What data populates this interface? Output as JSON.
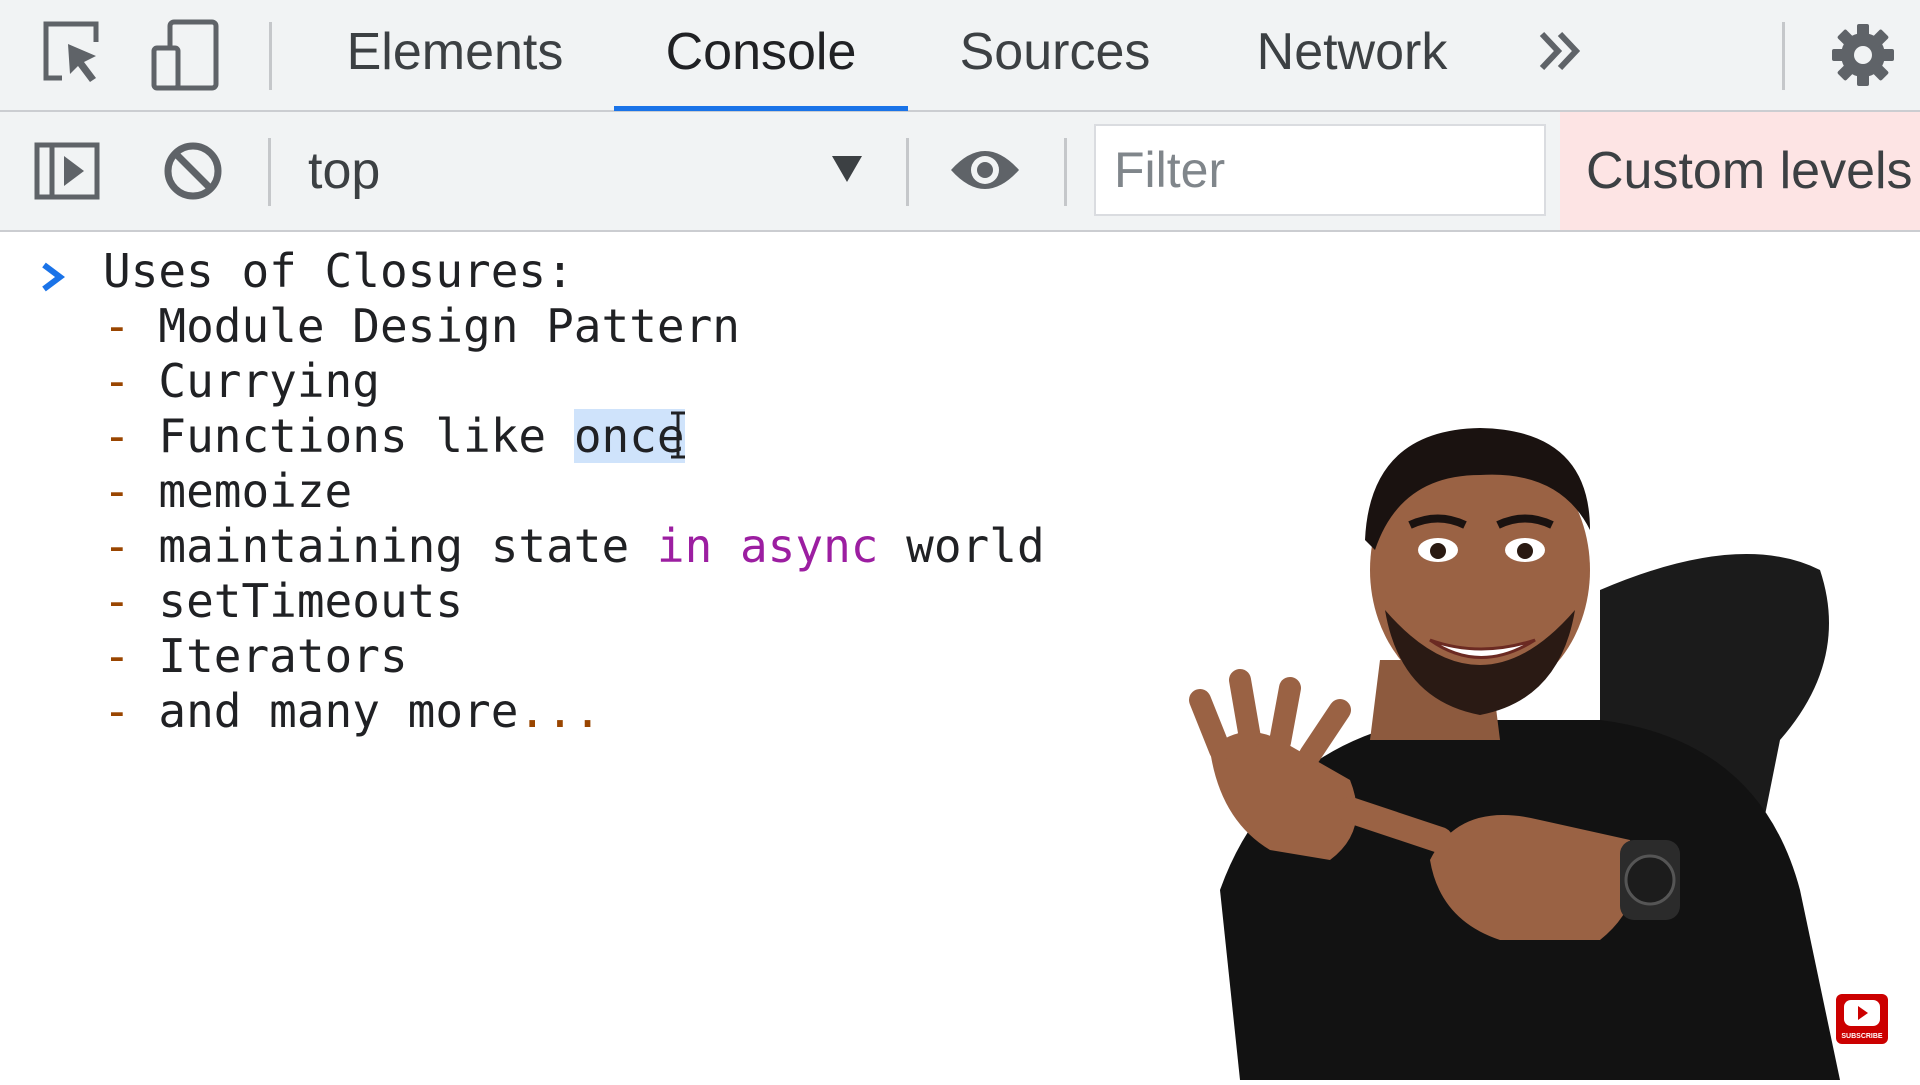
{
  "tabs": [
    {
      "label": "Elements",
      "active": false
    },
    {
      "label": "Console",
      "active": true
    },
    {
      "label": "Sources",
      "active": false
    },
    {
      "label": "Network",
      "active": false
    }
  ],
  "more_tabs_icon": "double-chevron-icon",
  "settings_icon": "gear-icon",
  "toolbar": {
    "context": "top",
    "filter_placeholder": "Filter",
    "levels_label": "Custom levels"
  },
  "console": {
    "heading": "Uses of Closures:",
    "items": [
      "Module Design Pattern",
      "Currying",
      "Functions like once",
      "memoize",
      "maintaining state in async world",
      "setTimeouts",
      "Iterators",
      "and many more..."
    ],
    "selected_word": "once"
  },
  "subscribe_label": "SUBSCRIBE",
  "colors": {
    "active_tab_underline": "#1a73e8",
    "levels_background": "#fde4e4",
    "dash": "#994500",
    "keyword": "#9c1ea1",
    "selection": "#cfe3fb"
  }
}
